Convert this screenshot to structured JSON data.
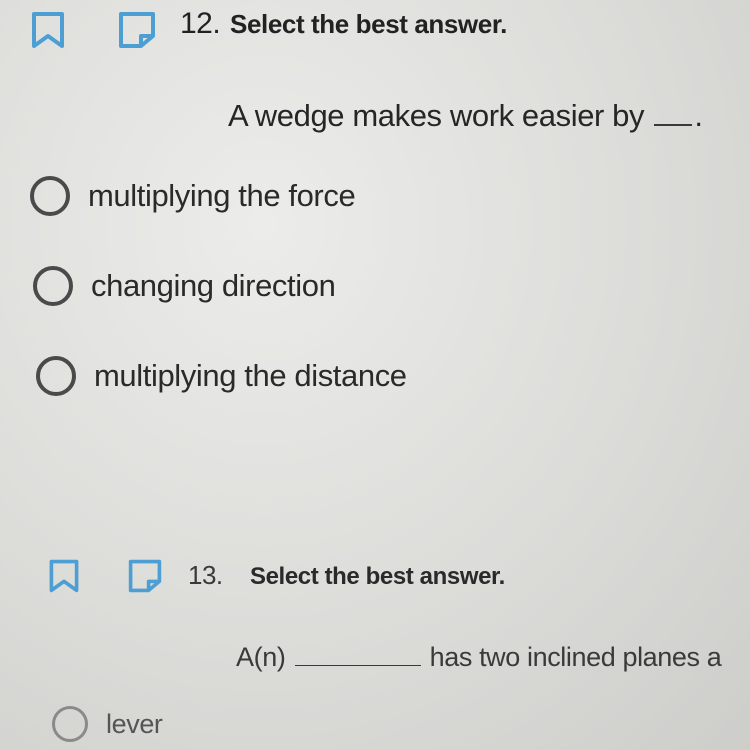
{
  "questions": [
    {
      "number": "12.",
      "instruction": "Select the best answer.",
      "stem_before": "A wedge makes work easier by",
      "stem_after": ".",
      "options": [
        "multiplying the force",
        "changing direction",
        "multiplying the distance"
      ]
    },
    {
      "number": "13.",
      "instruction": "Select the best answer.",
      "stem_before": "A(n)",
      "stem_after": "has two inclined planes a",
      "options": [
        "lever"
      ]
    }
  ],
  "colors": {
    "accent": "#4d9fd3",
    "background": "#e3e3e0",
    "text": "#2b2b2b"
  },
  "icons": {
    "bookmark": "bookmark-icon",
    "note": "note-icon"
  }
}
